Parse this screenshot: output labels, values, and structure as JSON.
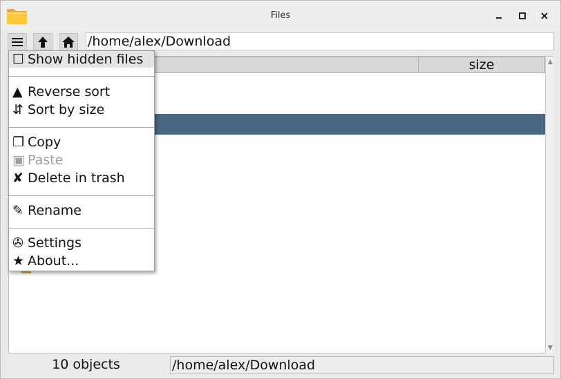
{
  "window": {
    "title": "Files",
    "controls": {
      "minimize": "×",
      "maximize": "□",
      "close": "×"
    }
  },
  "toolbar": {
    "menu_icon": "☰",
    "up_icon": "🡅",
    "home_icon": "⌂",
    "path": "/home/alex/Download"
  },
  "filelist": {
    "columns": [
      "size"
    ],
    "selected_row_color": "#4a6884"
  },
  "menu": {
    "items": [
      {
        "glyph": "☐",
        "label": "Show hidden files",
        "enabled": true
      },
      {
        "glyph": "▲",
        "label": "Reverse sort",
        "enabled": true
      },
      {
        "glyph": "⇵",
        "label": "Sort by size",
        "enabled": true
      },
      {
        "glyph": "❐",
        "label": "Copy",
        "enabled": true
      },
      {
        "glyph": "▣",
        "label": "Paste",
        "enabled": false
      },
      {
        "glyph": "✘",
        "label": "Delete in trash",
        "enabled": true
      },
      {
        "glyph": "✎",
        "label": "Rename",
        "enabled": true
      },
      {
        "glyph": "✇",
        "label": "Settings",
        "enabled": true
      },
      {
        "glyph": "★",
        "label": "About...",
        "enabled": true
      }
    ]
  },
  "statusbar": {
    "count": "10 objects",
    "path": "/home/alex/Download"
  }
}
